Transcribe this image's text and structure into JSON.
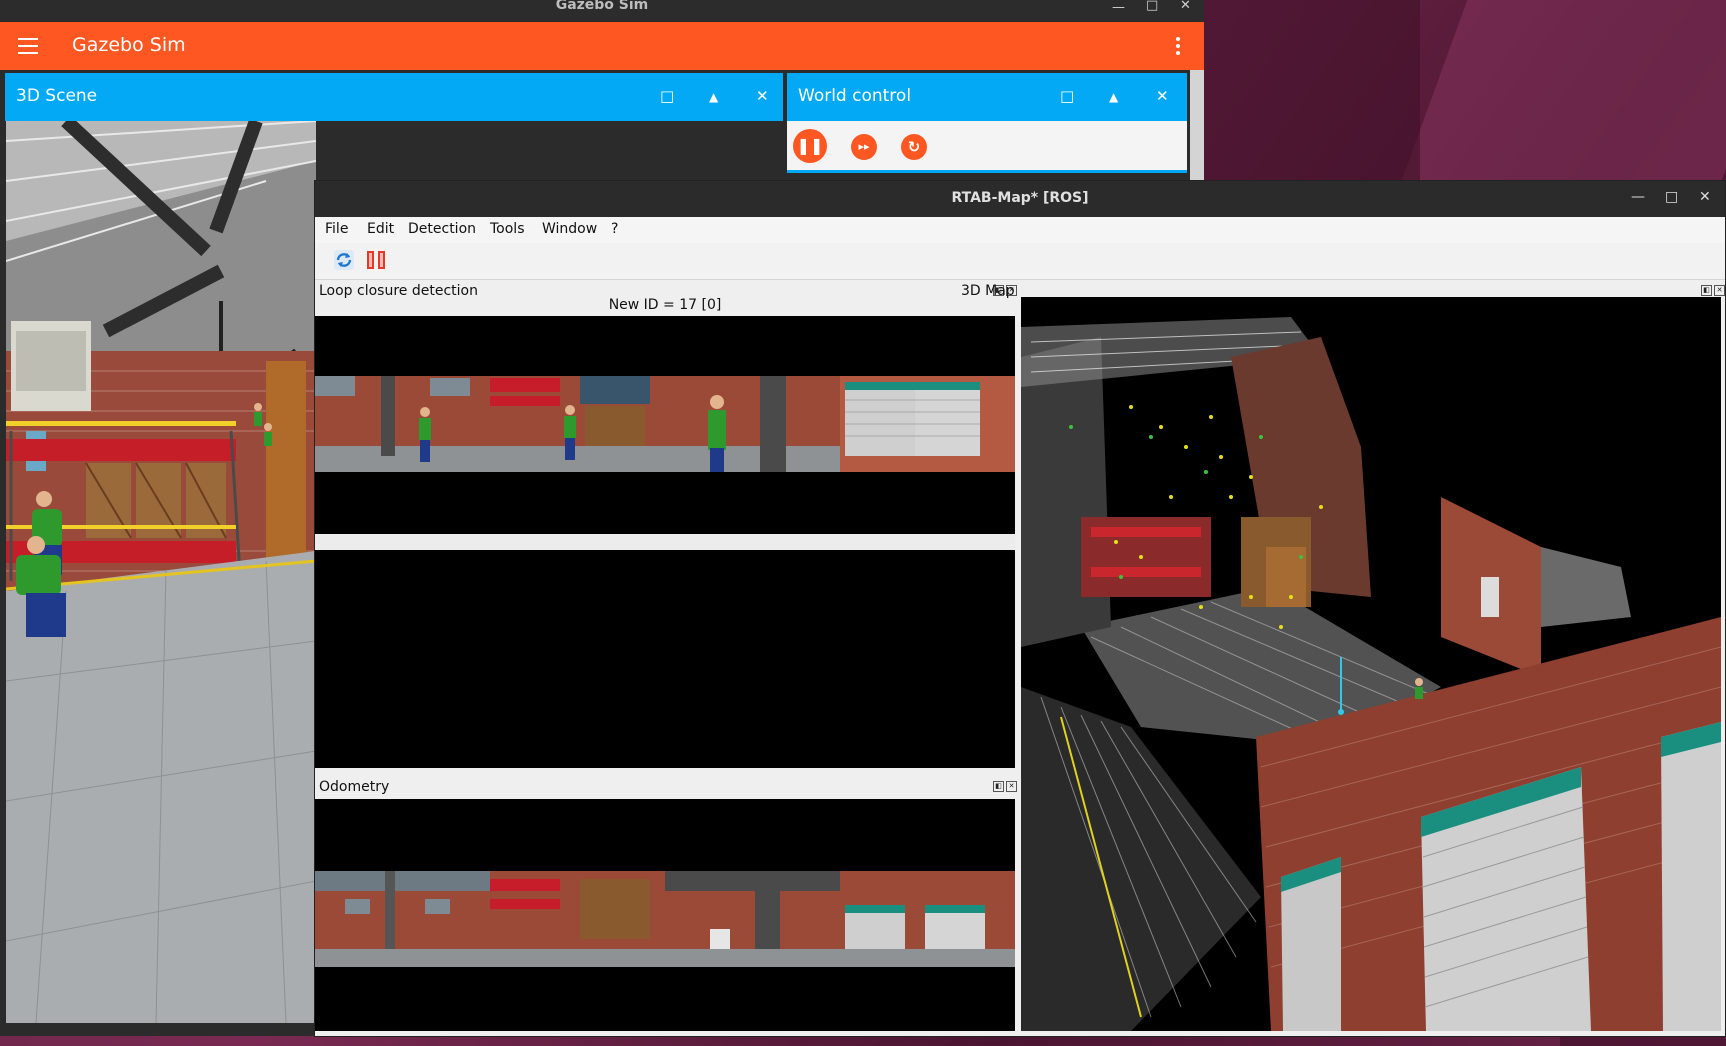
{
  "gazebo": {
    "window_title": "Gazebo Sim",
    "app_title": "Gazebo Sim",
    "scene_panel": {
      "title": "3D Scene"
    },
    "world_control": {
      "title": "World control"
    },
    "icons": {
      "maximize": "□",
      "collapse": "▲",
      "close": "✕",
      "pause": "❚❚",
      "step": "▸▸",
      "reset": "↻"
    }
  },
  "rtabmap": {
    "window_title": "RTAB-Map* [ROS]",
    "menu": [
      "File",
      "Edit",
      "Detection",
      "Tools",
      "Window",
      "?"
    ],
    "loop_closure": {
      "title": "Loop closure detection",
      "status": "New ID = 17 [0]"
    },
    "map3d": {
      "title": "3D Map"
    },
    "odometry": {
      "title": "Odometry"
    },
    "win_controls": {
      "minimize": "—",
      "maximize": "□",
      "close": "✕"
    }
  },
  "colors": {
    "gazebo_orange": "#fe5722",
    "gazebo_blue": "#03a9f4",
    "titlebar_dark": "#2b2b2b"
  }
}
